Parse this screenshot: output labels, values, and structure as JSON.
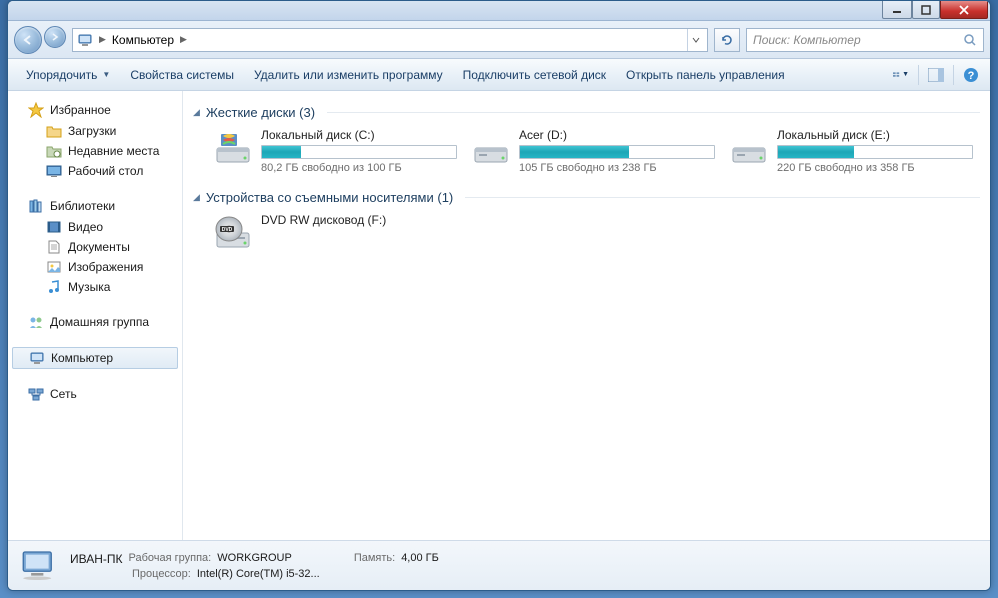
{
  "breadcrumb": {
    "root_icon": "computer",
    "location": "Компьютер"
  },
  "search": {
    "placeholder": "Поиск: Компьютер"
  },
  "toolbar": {
    "organize": "Упорядочить",
    "system_props": "Свойства системы",
    "uninstall": "Удалить или изменить программу",
    "map_drive": "Подключить сетевой диск",
    "control_panel": "Открыть панель управления"
  },
  "sidebar": {
    "favorites": {
      "label": "Избранное",
      "items": [
        {
          "label": "Загрузки",
          "icon": "downloads"
        },
        {
          "label": "Недавние места",
          "icon": "recent"
        },
        {
          "label": "Рабочий стол",
          "icon": "desktop"
        }
      ]
    },
    "libraries": {
      "label": "Библиотеки",
      "items": [
        {
          "label": "Видео",
          "icon": "video"
        },
        {
          "label": "Документы",
          "icon": "documents"
        },
        {
          "label": "Изображения",
          "icon": "pictures"
        },
        {
          "label": "Музыка",
          "icon": "music"
        }
      ]
    },
    "homegroup": {
      "label": "Домашняя группа"
    },
    "computer": {
      "label": "Компьютер"
    },
    "network": {
      "label": "Сеть"
    }
  },
  "sections": {
    "hard_drives": {
      "title": "Жесткие диски (3)",
      "drives": [
        {
          "name": "Локальный диск (C:)",
          "fill_pct": 20,
          "capacity": "80,2 ГБ свободно из 100 ГБ",
          "icon": "system"
        },
        {
          "name": "Acer (D:)",
          "fill_pct": 56,
          "capacity": "105 ГБ свободно из 238 ГБ",
          "icon": "hdd"
        },
        {
          "name": "Локальный диск (E:)",
          "fill_pct": 39,
          "capacity": "220 ГБ свободно из 358 ГБ",
          "icon": "hdd"
        }
      ]
    },
    "removable": {
      "title": "Устройства со съемными носителями (1)",
      "drives": [
        {
          "name": "DVD RW дисковод (F:)",
          "icon": "dvd"
        }
      ]
    }
  },
  "details": {
    "computer_name": "ИВАН-ПК",
    "workgroup_label": "Рабочая группа:",
    "workgroup": "WORKGROUP",
    "memory_label": "Память:",
    "memory": "4,00 ГБ",
    "cpu_label": "Процессор:",
    "cpu": "Intel(R) Core(TM) i5-32..."
  }
}
